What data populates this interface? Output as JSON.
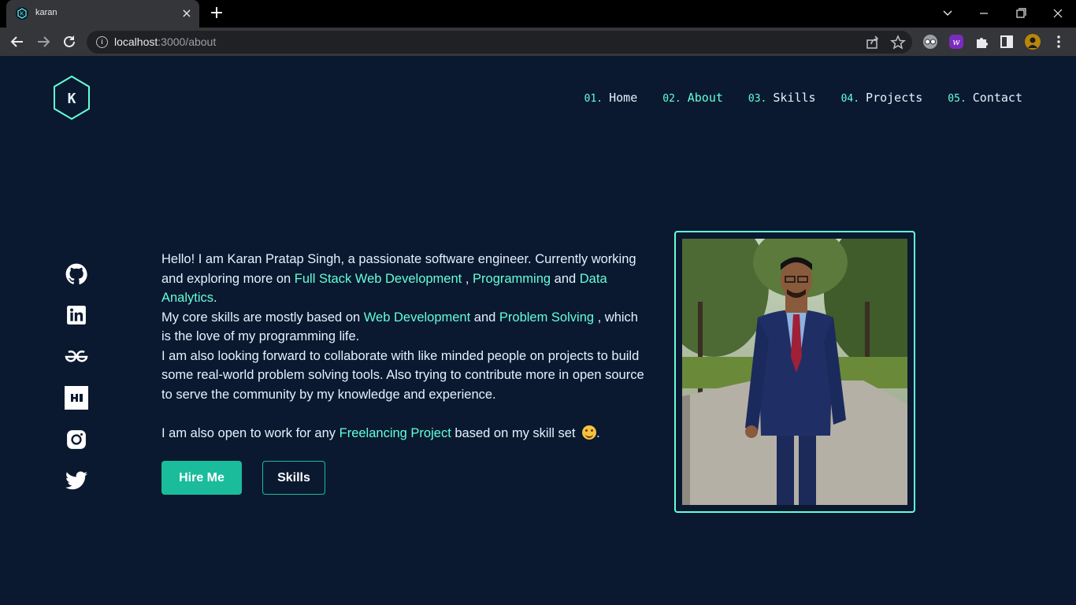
{
  "browser": {
    "tab_title": "karan",
    "new_tab_symbol": "+",
    "url_host": "localhost",
    "url_rest": ":3000/about"
  },
  "logo": {
    "letter": "K"
  },
  "nav": [
    {
      "num": "01.",
      "label": "Home"
    },
    {
      "num": "02.",
      "label": "About"
    },
    {
      "num": "03.",
      "label": "Skills"
    },
    {
      "num": "04.",
      "label": "Projects"
    },
    {
      "num": "05.",
      "label": "Contact"
    }
  ],
  "socials": [
    "github-icon",
    "linkedin-icon",
    "geeksforgeeks-icon",
    "hackerrank-icon",
    "instagram-icon",
    "twitter-icon"
  ],
  "about": {
    "p1": {
      "a": "Hello! I am Karan Pratap Singh, a passionate software engineer. Currently working and exploring more on ",
      "h1": "Full Stack Web Development",
      "b": " , ",
      "h2": "Programming",
      "c": " and ",
      "h3": "Data Analytics",
      "d": "."
    },
    "p2": {
      "a": "My core skills are mostly based on ",
      "h1": "Web Development",
      "b": " and ",
      "h2": "Problem Solving",
      "c": " , which is the love of my programming life."
    },
    "p3": "I am also looking forward to collaborate with like minded people on projects to build some real-world problem solving tools. Also trying to contribute more in open source to serve the community by my knowledge and experience.",
    "p4": {
      "a": "I am also open to work for any ",
      "h1": "Freelancing Project",
      "b": " based on my skill set ",
      "c": "."
    }
  },
  "buttons": {
    "primary": "Hire Me",
    "secondary": "Skills"
  },
  "colors": {
    "background": "#0a192f",
    "accent": "#64ffda",
    "button": "#1abc9c"
  }
}
